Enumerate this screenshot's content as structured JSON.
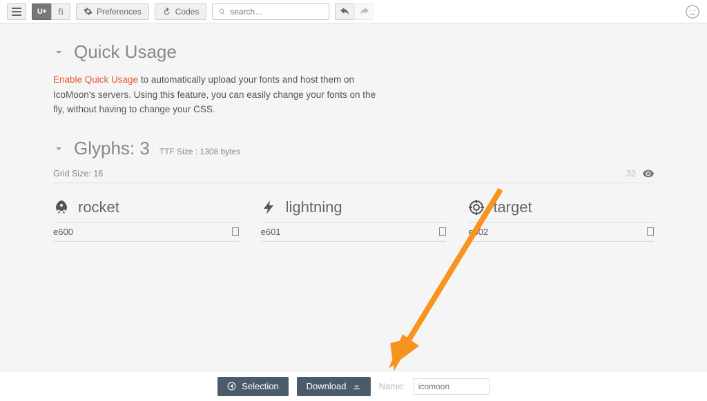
{
  "toolbar": {
    "preferences_label": "Preferences",
    "codes_label": "Codes",
    "search_placeholder": "search…"
  },
  "quick_usage": {
    "title": "Quick Usage",
    "link_text": "Enable Quick Usage",
    "desc_rest": " to automatically upload your fonts and host them on IcoMoon's servers. Using this feature, you can easily change your fonts on the fly, without having to change your CSS."
  },
  "glyphs": {
    "title_prefix": "Glyphs: ",
    "count": "3",
    "ttf_size_label": "TTF Size : 1308 bytes",
    "grid_size_label": "Grid Size: 16",
    "right_number": "32",
    "items": [
      {
        "name": "rocket",
        "code": "e600",
        "icon": "rocket"
      },
      {
        "name": "lightning",
        "code": "e601",
        "icon": "lightning"
      },
      {
        "name": "target",
        "code": "e602",
        "icon": "target"
      }
    ]
  },
  "footer": {
    "selection_label": "Selection",
    "download_label": "Download",
    "name_label": "Name:",
    "name_placeholder": "icomoon"
  }
}
